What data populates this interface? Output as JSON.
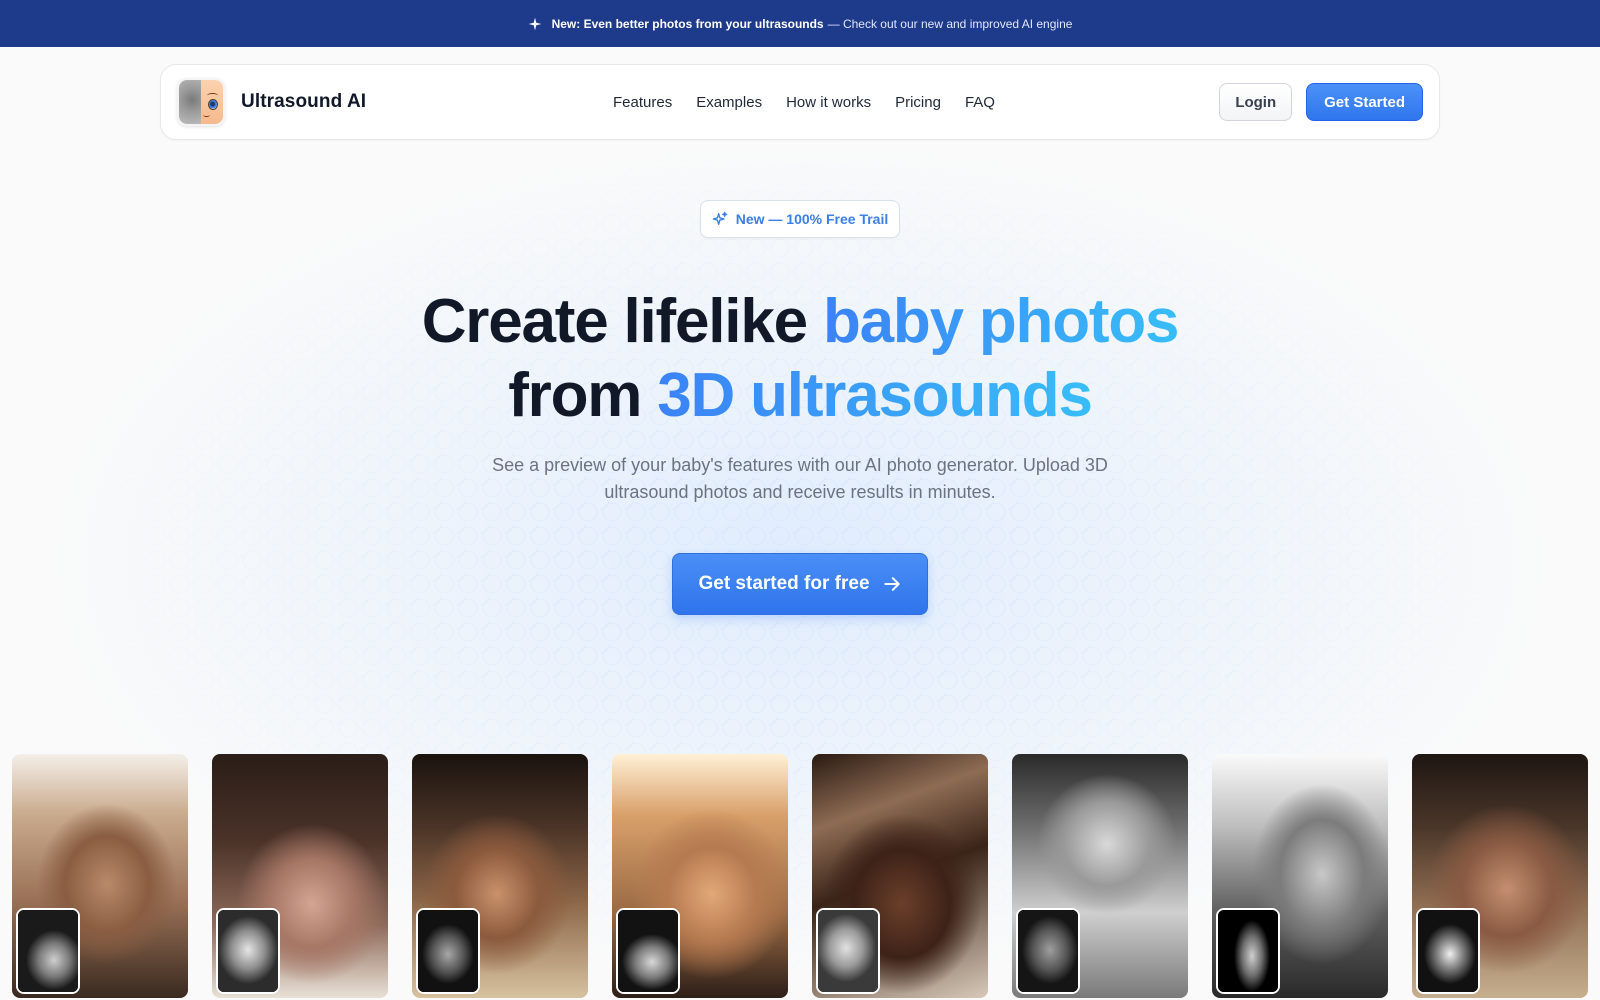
{
  "announcement": {
    "icon": "sparkle-icon",
    "bold": "New: Even better photos from your ultrasounds",
    "rest": "— Check out our new and improved AI engine"
  },
  "nav": {
    "brand": "Ultrasound AI",
    "links": [
      "Features",
      "Examples",
      "How it works",
      "Pricing",
      "FAQ"
    ],
    "login": "Login",
    "get_started": "Get Started"
  },
  "hero": {
    "badge": "New — 100% Free Trail",
    "headline_line1_plain": "Create lifelike ",
    "headline_line1_accent": "baby photos",
    "headline_line2_plain": "from ",
    "headline_line2_accent": "3D ultrasounds",
    "subtitle": "See a preview of your baby's features with our AI photo generator. Upload 3D ultrasound photos and receive results in minutes.",
    "cta": "Get started for free",
    "accent_colors": [
      "#3b82f6",
      "#38bdf8"
    ]
  },
  "gallery": [
    {
      "name": "baby-photo-1",
      "tone": "warm-light",
      "ultrasound": "ultrasound-1"
    },
    {
      "name": "baby-photo-2",
      "tone": "warm-dark",
      "ultrasound": "ultrasound-2"
    },
    {
      "name": "baby-photo-3",
      "tone": "amber",
      "ultrasound": "ultrasound-3"
    },
    {
      "name": "baby-photo-4",
      "tone": "golden",
      "ultrasound": "ultrasound-4"
    },
    {
      "name": "baby-photo-5",
      "tone": "deep-brown",
      "ultrasound": "ultrasound-5"
    },
    {
      "name": "baby-photo-6",
      "tone": "monochrome",
      "ultrasound": "ultrasound-6"
    },
    {
      "name": "baby-photo-7",
      "tone": "monochrome-light",
      "ultrasound": "ultrasound-7"
    },
    {
      "name": "baby-photo-8",
      "tone": "warm-brown",
      "ultrasound": "ultrasound-8"
    }
  ]
}
